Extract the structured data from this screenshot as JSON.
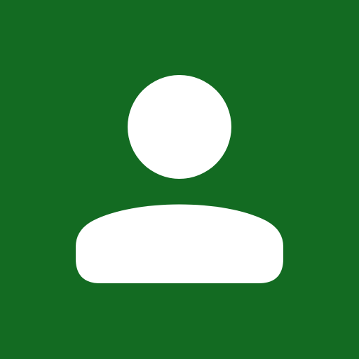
{
  "avatar": {
    "icon": "user-icon",
    "background_color": "#136b22",
    "foreground_color": "#ffffff"
  }
}
